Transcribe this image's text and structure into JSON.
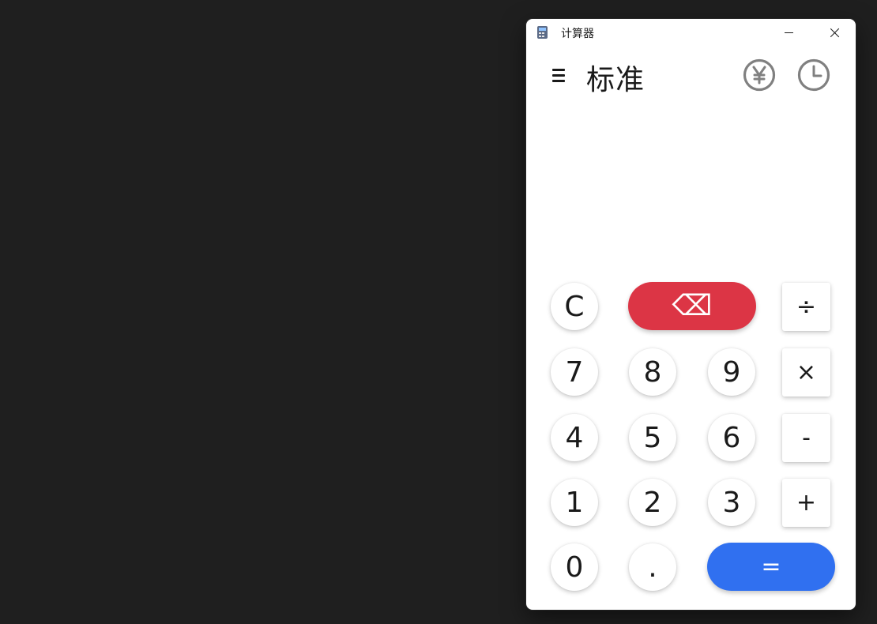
{
  "window": {
    "title": "计算器",
    "minimize_label": "",
    "close_label": ""
  },
  "header": {
    "mode_title": "标准",
    "currency_icon": "yen-circle-icon",
    "history_icon": "clock-icon"
  },
  "display": {
    "expression": "",
    "value": ""
  },
  "keys": {
    "clear": "C",
    "backspace": "⌫",
    "divide": "÷",
    "seven": "7",
    "eight": "8",
    "nine": "9",
    "multiply": "×",
    "four": "4",
    "five": "5",
    "six": "6",
    "subtract": "-",
    "one": "1",
    "two": "2",
    "three": "3",
    "add": "+",
    "zero": "0",
    "decimal": ".",
    "equals": "="
  },
  "colors": {
    "desktop_bg": "#1f1f1f",
    "backspace": "#dc3545",
    "equals": "#3070f0",
    "icon_gray": "#808080"
  }
}
